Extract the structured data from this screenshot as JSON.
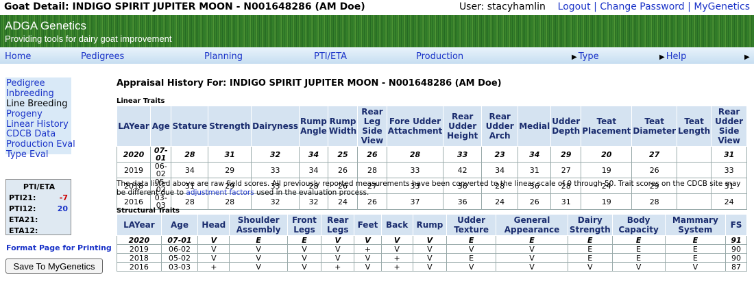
{
  "topbar": {
    "title": "Goat Detail: INDIGO SPIRIT JUPITER MOON - N001648286 (AM Doe)",
    "user_label": "User: stacyhamlin",
    "logout": "Logout",
    "change_password": "Change Password",
    "my_genetics": "MyGenetics",
    "separator": "|"
  },
  "banner": {
    "title": "ADGA Genetics",
    "subtitle": "Providing tools for dairy goat improvement"
  },
  "nav": {
    "home": "Home",
    "pedigrees": "Pedigrees",
    "planning": "Planning",
    "pti_eta": "PTI/ETA",
    "production": "Production",
    "type": "Type",
    "help": "Help"
  },
  "sidebar": {
    "items": [
      "Pedigree",
      "Inbreeding",
      "Line Breeding",
      "Progeny",
      "Linear History",
      "CDCB Data",
      "Production Eval",
      "Type Eval"
    ],
    "pti": {
      "title": "PTI/ETA",
      "rows": [
        {
          "label": "PTI21:",
          "value": "-7",
          "color": "#cc0000"
        },
        {
          "label": "PTI12:",
          "value": "20",
          "color": "#1a33c8"
        },
        {
          "label": "ETA21:",
          "value": ""
        },
        {
          "label": "ETA12:",
          "value": ""
        }
      ]
    },
    "print_link": "Format Page for Printing",
    "save_button": "Save To MyGenetics"
  },
  "main": {
    "appraisal_title": "Appraisal History For: INDIGO SPIRIT JUPITER MOON - N001648286 (AM Doe)",
    "linear_label": "Linear Traits",
    "linear_headers": [
      "LAYear",
      "Age",
      "Stature",
      "Strength",
      "Dairyness",
      "Rump Angle",
      "Rump Width",
      "Rear Leg Side View",
      "Fore Udder Attachment",
      "Rear Udder Height",
      "Rear Udder Arch",
      "Medial",
      "Udder Depth",
      "Teat Placement",
      "Teat Diameter",
      "Teat Length",
      "Rear Udder Side View"
    ],
    "linear_rows": [
      [
        "2020",
        "07-01",
        "28",
        "31",
        "32",
        "34",
        "25",
        "26",
        "28",
        "33",
        "23",
        "34",
        "29",
        "20",
        "27",
        "",
        "31"
      ],
      [
        "2019",
        "06-02",
        "34",
        "29",
        "33",
        "34",
        "26",
        "28",
        "33",
        "42",
        "34",
        "31",
        "27",
        "19",
        "26",
        "",
        "33"
      ],
      [
        "2018",
        "05-02",
        "31",
        "29",
        "33",
        "28",
        "26",
        "27",
        "33",
        "36",
        "28",
        "36",
        "28",
        "24",
        "29",
        "",
        "31"
      ],
      [
        "2016",
        "03-03",
        "28",
        "28",
        "32",
        "32",
        "24",
        "26",
        "37",
        "36",
        "24",
        "26",
        "31",
        "19",
        "28",
        "",
        "24"
      ]
    ],
    "note_text": "The data listed above are raw field scores. All previously reported measurements have been converted to the linear scale of 0 through 50. Trait scores on the CDCB site may be different due to ",
    "note_link": "adjustment factors",
    "note_end": " used in the evaluation process.",
    "structural_label": "Structural Traits",
    "structural_headers": [
      "LAYear",
      "Age",
      "Head",
      "Shoulder Assembly",
      "Front Legs",
      "Rear Legs",
      "Feet",
      "Back",
      "Rump",
      "Udder Texture",
      "General Appearance",
      "Dairy Strength",
      "Body Capacity",
      "Mammary System",
      "FS"
    ],
    "structural_rows": [
      [
        "2020",
        "07-01",
        "V",
        "E",
        "E",
        "V",
        "V",
        "V",
        "V",
        "E",
        "E",
        "E",
        "E",
        "E",
        "91"
      ],
      [
        "2019",
        "06-02",
        "V",
        "V",
        "V",
        "V",
        "+",
        "V",
        "V",
        "V",
        "V",
        "E",
        "E",
        "E",
        "90"
      ],
      [
        "2018",
        "05-02",
        "V",
        "V",
        "V",
        "V",
        "V",
        "+",
        "V",
        "E",
        "V",
        "E",
        "E",
        "E",
        "90"
      ],
      [
        "2016",
        "03-03",
        "+",
        "V",
        "V",
        "+",
        "V",
        "+",
        "V",
        "V",
        "V",
        "V",
        "V",
        "V",
        "87"
      ]
    ]
  }
}
